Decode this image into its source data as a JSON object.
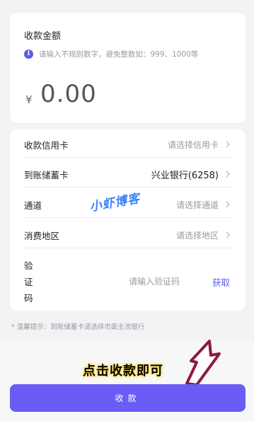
{
  "amount": {
    "title": "收款金额",
    "hint": "请输入不规则数字，避免整数如：999、1000等",
    "currency": "¥",
    "value": "0.00"
  },
  "form": {
    "rows": [
      {
        "label": "收款信用卡",
        "value": "请选择信用卡"
      },
      {
        "label": "到账储蓄卡",
        "value": "兴业银行(6258)"
      },
      {
        "label": "通道",
        "value": "请选择通道"
      },
      {
        "label": "消费地区",
        "value": "请选择地区"
      }
    ],
    "code": {
      "label": "验证码",
      "placeholder": "请输入验证码",
      "get": "获取"
    }
  },
  "tip": "* 温馨提示：到账储蓄卡请选择市面主流银行",
  "watermark": "小虾博客",
  "overlay_label": "点击收款即可",
  "submit_label": "收款",
  "colors": {
    "accent": "#6a5cf4",
    "info_icon": "#5b5ce8",
    "link": "#5b5ce8",
    "arrow": "#8e1a3a",
    "watermark": "#3b82f6"
  }
}
